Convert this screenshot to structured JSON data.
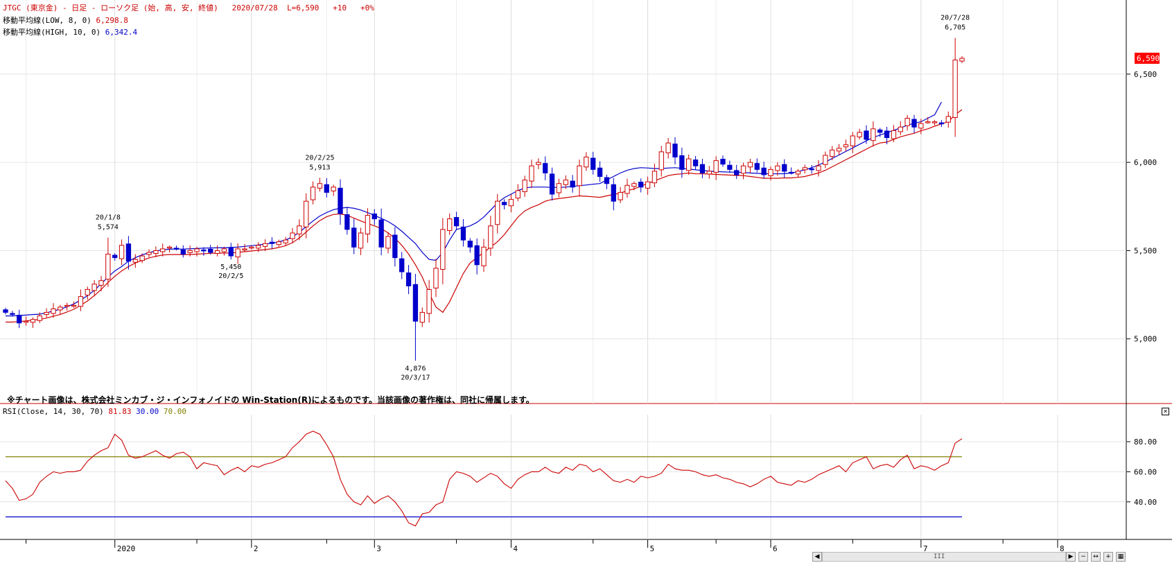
{
  "header": {
    "symbol": "JTGC (東京金) - 日足 - ローソク足 (始, 高, 安, 終値)",
    "date": "2020/07/28",
    "last": "L=6,590",
    "change": "+10",
    "change_pct": "+0%",
    "ma_low_label": "移動平均線(LOW, 8, 0)",
    "ma_low_value": "6,298.8",
    "ma_high_label": "移動平均線(HIGH, 10, 0)",
    "ma_high_value": "6,342.4",
    "colors": {
      "title": "#cc0000",
      "ma_low": "#cc0000",
      "ma_high": "#0000cc"
    }
  },
  "notice": "※チャート画像は、株式会社ミンカブ・ジ・インフォノイドの Win-Station(R)によるものです。当該画像の著作権は、同社に帰属します。",
  "price_badge": "6,590",
  "rsi_header": {
    "label": "RSI(Close, 14, 30, 70)",
    "value": "81.83",
    "lower": "30.00",
    "upper": "70.00"
  },
  "scrollbar": {
    "thumb": "III"
  },
  "chart_data": [
    {
      "type": "candlestick",
      "colors": {
        "up": "#cc0000",
        "down": "#0000cc",
        "ma_low": "#cc0000",
        "ma_high": "#0000cc"
      },
      "y_ticks": [
        "5,000",
        "5,500",
        "6,000",
        "6,500"
      ],
      "y_tick_values": [
        5000,
        5500,
        6000,
        6500
      ],
      "ylim": [
        4720,
        6920
      ],
      "x_labels": [
        "2020",
        "2",
        "3",
        "4",
        "5",
        "6",
        "7",
        "8"
      ],
      "annotations": [
        {
          "date": "20/1/8",
          "value": "5,574",
          "position": "above",
          "idx": 15
        },
        {
          "date": "20/2/5",
          "value": "5,450",
          "position": "below",
          "idx": 33
        },
        {
          "date": "20/2/25",
          "value": "5,913",
          "position": "above",
          "idx": 46
        },
        {
          "date": "20/3/17",
          "value": "4,876",
          "position": "below",
          "idx": 60
        },
        {
          "date": "20/7/28",
          "value": "6,705",
          "position": "above",
          "idx": 139
        }
      ],
      "closes": [
        5150,
        5140,
        5090,
        5100,
        5110,
        5130,
        5150,
        5170,
        5180,
        5190,
        5190,
        5240,
        5280,
        5310,
        5330,
        5480,
        5460,
        5530,
        5440,
        5450,
        5470,
        5490,
        5500,
        5510,
        5520,
        5510,
        5480,
        5500,
        5510,
        5500,
        5490,
        5500,
        5510,
        5470,
        5510,
        5510,
        5520,
        5530,
        5540,
        5540,
        5550,
        5560,
        5600,
        5640,
        5780,
        5860,
        5880,
        5830,
        5860,
        5710,
        5620,
        5520,
        5600,
        5700,
        5680,
        5520,
        5580,
        5460,
        5380,
        5300,
        5100,
        5150,
        5280,
        5400,
        5620,
        5680,
        5640,
        5560,
        5520,
        5420,
        5520,
        5640,
        5780,
        5760,
        5790,
        5840,
        5900,
        5980,
        6000,
        5940,
        5820,
        5880,
        5900,
        5860,
        5980,
        6030,
        5960,
        5920,
        5880,
        5780,
        5830,
        5870,
        5880,
        5860,
        5890,
        5950,
        6060,
        6110,
        6030,
        5960,
        6020,
        5980,
        5940,
        5950,
        6010,
        5990,
        5960,
        5930,
        5980,
        6000,
        5960,
        5930,
        5960,
        5980,
        5950,
        5940,
        5950,
        5970,
        5960,
        5980,
        6040,
        6070,
        6080,
        6100,
        6150,
        6170,
        6130,
        6190,
        6170,
        6140,
        6180,
        6200,
        6250,
        6200,
        6220,
        6230,
        6230,
        6220,
        6260,
        6580,
        6590
      ],
      "ma_low": [
        5095,
        5095,
        5098,
        5102,
        5106,
        5110,
        5118,
        5128,
        5138,
        5152,
        5168,
        5190,
        5215,
        5245,
        5280,
        5320,
        5355,
        5385,
        5410,
        5430,
        5445,
        5458,
        5468,
        5475,
        5478,
        5478,
        5478,
        5478,
        5480,
        5482,
        5485,
        5486,
        5486,
        5487,
        5490,
        5494,
        5498,
        5502,
        5506,
        5510,
        5518,
        5528,
        5545,
        5572,
        5605,
        5640,
        5670,
        5692,
        5705,
        5708,
        5700,
        5684,
        5668,
        5654,
        5640,
        5625,
        5600,
        5570,
        5530,
        5480,
        5420,
        5350,
        5260,
        5180,
        5150,
        5210,
        5290,
        5370,
        5430,
        5460,
        5490,
        5520,
        5550,
        5590,
        5640,
        5690,
        5725,
        5745,
        5760,
        5780,
        5790,
        5795,
        5800,
        5805,
        5810,
        5808,
        5805,
        5802,
        5810,
        5818,
        5826,
        5840,
        5850,
        5865,
        5880,
        5895,
        5910,
        5925,
        5932,
        5935,
        5940,
        5935,
        5935,
        5934,
        5932,
        5930,
        5928,
        5926,
        5925,
        5920,
        5915,
        5910,
        5910,
        5910,
        5912,
        5912,
        5915,
        5920,
        5930,
        5940,
        5955,
        5975,
        5995,
        6015,
        6035,
        6055,
        6075,
        6095,
        6110,
        6115,
        6130,
        6145,
        6155,
        6165,
        6180,
        6190,
        6205,
        6218,
        6230,
        6270,
        6299
      ],
      "ma_high": [
        5130,
        5130,
        5132,
        5135,
        5138,
        5140,
        5148,
        5158,
        5168,
        5182,
        5198,
        5220,
        5245,
        5275,
        5312,
        5350,
        5385,
        5410,
        5440,
        5460,
        5476,
        5488,
        5498,
        5505,
        5508,
        5509,
        5509,
        5510,
        5512,
        5514,
        5515,
        5516,
        5516,
        5518,
        5520,
        5524,
        5528,
        5532,
        5538,
        5542,
        5550,
        5560,
        5578,
        5604,
        5636,
        5668,
        5696,
        5716,
        5732,
        5740,
        5745,
        5740,
        5730,
        5715,
        5700,
        5682,
        5665,
        5640,
        5610,
        5575,
        5540,
        5490,
        5450,
        5445,
        5490,
        5560,
        5620,
        5630,
        5640,
        5660,
        5690,
        5730,
        5770,
        5800,
        5820,
        5840,
        5855,
        5860,
        5860,
        5860,
        5858,
        5858,
        5860,
        5864,
        5868,
        5872,
        5876,
        5880,
        5900,
        5920,
        5940,
        5955,
        5965,
        5970,
        5968,
        5965,
        5965,
        5968,
        5970,
        5966,
        5962,
        5958,
        5954,
        5950,
        5948,
        5946,
        5945,
        5944,
        5943,
        5940,
        5938,
        5936,
        5935,
        5935,
        5936,
        5940,
        5948,
        5958,
        5970,
        5985,
        6002,
        6022,
        6042,
        6062,
        6082,
        6102,
        6122,
        6140,
        6155,
        6168,
        6182,
        6195,
        6210,
        6222,
        6230,
        6250,
        6270,
        6342
      ],
      "rsi": {
        "ylim": [
          15,
          98
        ],
        "y_ticks": [
          "40.00",
          "60.00",
          "80.00"
        ],
        "y_tick_values": [
          40,
          60,
          80
        ],
        "upper": 70,
        "lower": 30,
        "colors": {
          "line": "#cc0000",
          "upper": "#808000",
          "lower": "#0000cc"
        },
        "values": [
          54,
          49,
          41,
          42,
          45,
          53,
          57,
          60,
          59,
          60,
          60,
          61,
          67,
          71,
          74,
          76,
          85,
          81,
          71,
          69,
          70,
          72,
          74,
          71,
          69,
          72,
          73,
          70,
          62,
          66,
          65,
          64,
          58,
          61,
          63,
          60,
          64,
          63,
          65,
          66,
          68,
          70,
          76,
          80,
          85,
          87,
          85,
          78,
          70,
          55,
          45,
          40,
          38,
          44,
          39,
          42,
          44,
          40,
          34,
          26,
          24,
          32,
          33,
          38,
          40,
          55,
          60,
          59,
          57,
          53,
          56,
          59,
          57,
          52,
          49,
          55,
          58,
          60,
          60,
          63,
          60,
          59,
          63,
          61,
          65,
          64,
          60,
          62,
          58,
          54,
          53,
          55,
          53,
          57,
          56,
          57,
          59,
          65,
          62,
          61,
          61,
          60,
          58,
          57,
          58,
          56,
          55,
          53,
          52,
          50,
          52,
          55,
          57,
          53,
          52,
          51,
          54,
          53,
          55,
          58,
          60,
          62,
          64,
          60,
          66,
          68,
          70,
          62,
          64,
          65,
          63,
          68,
          71,
          62,
          64,
          63,
          61,
          64,
          66,
          79,
          82
        ]
      }
    }
  ]
}
